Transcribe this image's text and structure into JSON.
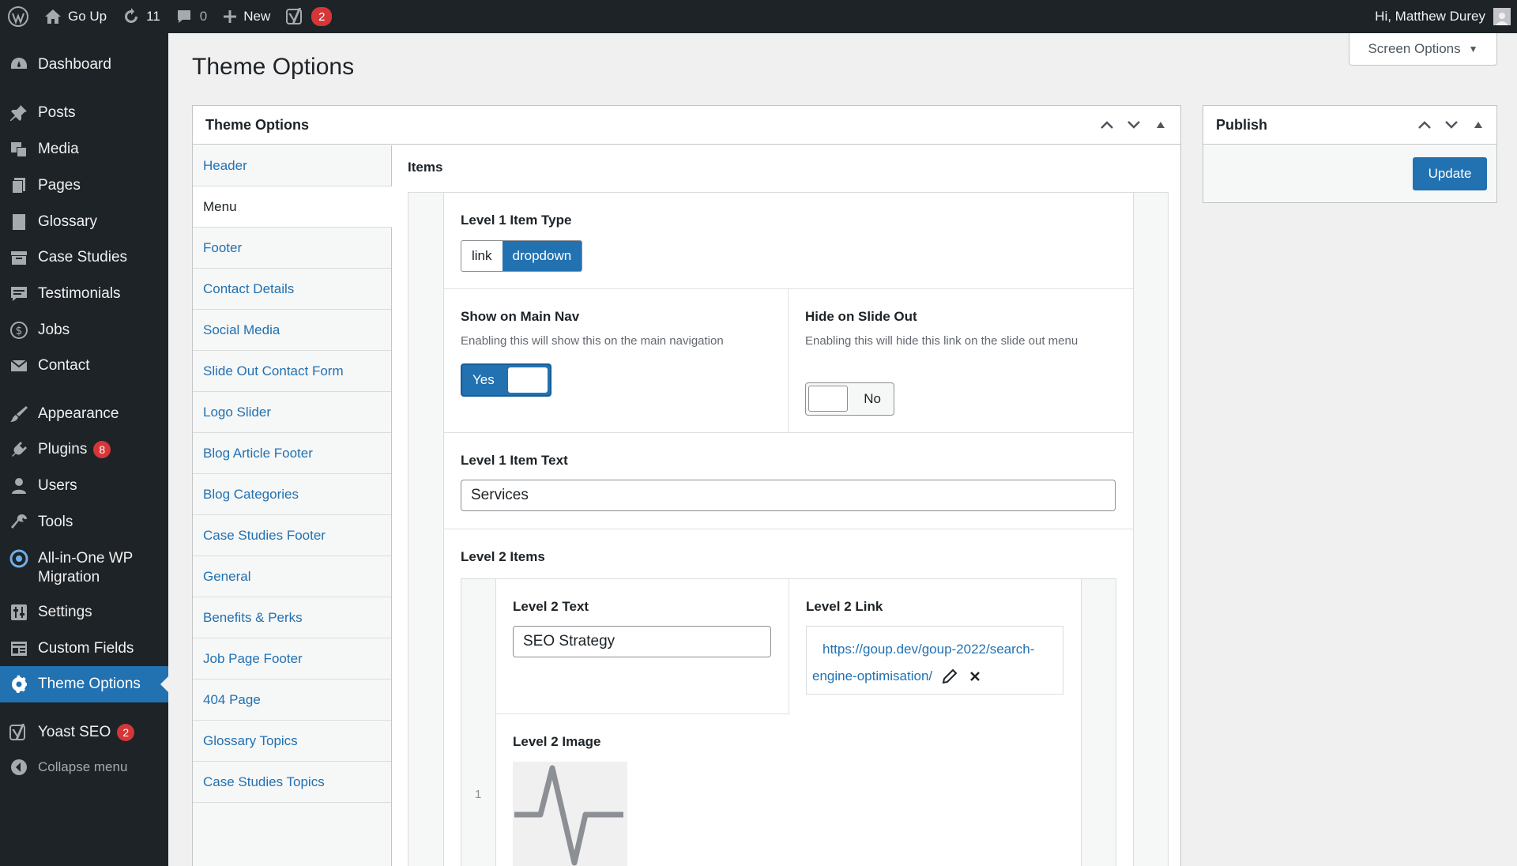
{
  "adminbar": {
    "site_name": "Go Up",
    "updates_count": "11",
    "comments_count": "0",
    "new_label": "New",
    "yoast_count": "2",
    "greeting": "Hi, Matthew Durey"
  },
  "sidebar": {
    "items": [
      {
        "label": "Dashboard",
        "icon": "dashboard-icon"
      },
      {
        "label": "Posts",
        "icon": "pin-icon"
      },
      {
        "label": "Media",
        "icon": "media-icon"
      },
      {
        "label": "Pages",
        "icon": "pages-icon"
      },
      {
        "label": "Glossary",
        "icon": "book-icon"
      },
      {
        "label": "Case Studies",
        "icon": "archive-icon"
      },
      {
        "label": "Testimonials",
        "icon": "testimonial-icon"
      },
      {
        "label": "Jobs",
        "icon": "dollar-icon"
      },
      {
        "label": "Contact",
        "icon": "email-icon"
      },
      {
        "label": "Appearance",
        "icon": "brush-icon"
      },
      {
        "label": "Plugins",
        "icon": "plugin-icon",
        "badge": "8"
      },
      {
        "label": "Users",
        "icon": "users-icon"
      },
      {
        "label": "Tools",
        "icon": "wrench-icon"
      },
      {
        "label": "All-in-One WP",
        "label2": "Migration",
        "icon": "migration-icon"
      },
      {
        "label": "Settings",
        "icon": "settings-icon"
      },
      {
        "label": "Custom Fields",
        "icon": "fields-icon"
      },
      {
        "label": "Theme Options",
        "icon": "gear-icon",
        "current": true
      },
      {
        "label": "Yoast SEO",
        "icon": "yoast-icon",
        "badge": "2"
      },
      {
        "label": "Collapse menu",
        "icon": "collapse-icon"
      }
    ]
  },
  "page": {
    "title": "Theme Options",
    "screen_options": "Screen Options"
  },
  "theme_box": {
    "title": "Theme Options",
    "tabs": [
      "Header",
      "Menu",
      "Footer",
      "Contact Details",
      "Social Media",
      "Slide Out Contact Form",
      "Logo Slider",
      "Blog Article Footer",
      "Blog Categories",
      "Case Studies Footer",
      "General",
      "Benefits & Perks",
      "Job Page Footer",
      "404 Page",
      "Glossary Topics",
      "Case Studies Topics"
    ],
    "active_tab": "Menu",
    "items_label": "Items",
    "level1_type_label": "Level 1 Item Type",
    "type_options": [
      "link",
      "dropdown"
    ],
    "type_selected": "dropdown",
    "show_main_nav_label": "Show on Main Nav",
    "show_main_nav_desc": "Enabling this will show this on the main navigation",
    "show_main_nav_value": "Yes",
    "hide_slide_label": "Hide on Slide Out",
    "hide_slide_desc": "Enabling this will hide this link on the slide out menu",
    "hide_slide_value": "No",
    "level1_text_label": "Level 1 Item Text",
    "level1_text_value": "Services",
    "level2_items_label": "Level 2 Items",
    "row_number": "1",
    "level2_text_label": "Level 2 Text",
    "level2_text_value": "SEO Strategy",
    "level2_link_label": "Level 2 Link",
    "level2_link_line1": "https://goup.dev/goup-2022/search-",
    "level2_link_line2": "engine-optimisation/",
    "level2_image_label": "Level 2 Image"
  },
  "publish_box": {
    "title": "Publish",
    "update_label": "Update"
  },
  "colors": {
    "accent": "#2271b1",
    "adminbar": "#1d2327",
    "badge": "#d63638"
  }
}
